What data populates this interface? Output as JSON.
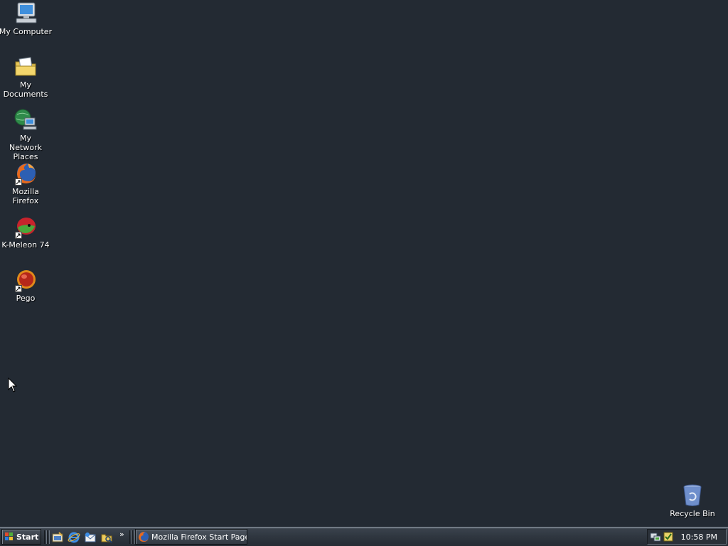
{
  "desktop": {
    "background_color": "#232a33",
    "icons": [
      {
        "label": "My Computer",
        "icon": "my-computer-icon"
      },
      {
        "label": "My Documents",
        "icon": "my-documents-icon"
      },
      {
        "label": "My Network Places",
        "icon": "network-places-icon"
      },
      {
        "label": "Mozilla Firefox",
        "icon": "firefox-icon"
      },
      {
        "label": "K-Meleon 74",
        "icon": "kmeleon-icon"
      },
      {
        "label": "Pego",
        "icon": "pego-icon"
      },
      {
        "label": "Recycle Bin",
        "icon": "recycle-bin-icon"
      }
    ]
  },
  "taskbar": {
    "start_label": "Start",
    "quick_launch": [
      "show-desktop-icon",
      "internet-explorer-icon",
      "outlook-express-icon",
      "windows-explorer-icon"
    ],
    "chevron": "»",
    "tasks": [
      {
        "label": "Mozilla Firefox Start Page...",
        "icon": "firefox-icon"
      }
    ],
    "tray_icons": [
      "network-tray-icon",
      "security-tray-icon"
    ],
    "clock": "10:58 PM"
  }
}
